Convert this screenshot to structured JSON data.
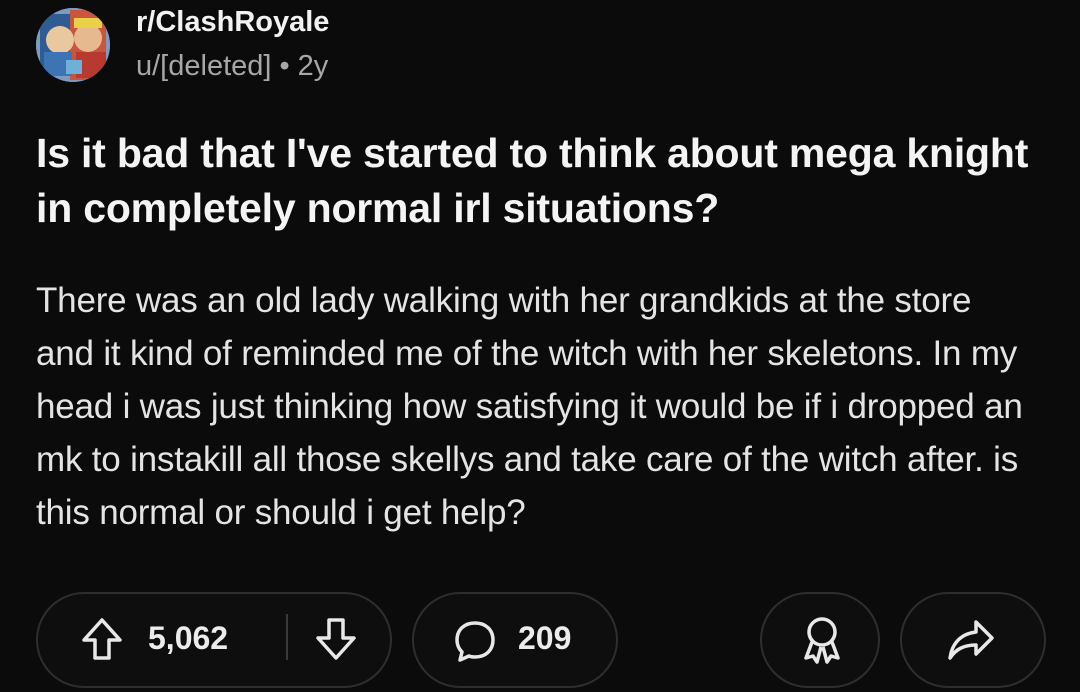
{
  "post": {
    "subreddit": "r/ClashRoyale",
    "author": "u/[deleted]",
    "separator": "•",
    "age": "2y",
    "title": "Is it bad that I've started to think about mega knight in completely normal irl situations?",
    "body": "There was an old lady walking with her grandkids at the store and it kind of reminded me of the witch with her skeletons. In my head i was just thinking how satisfying it would be if i dropped an mk to instakill all those skellys and take care of the witch after. is this normal or should i get help?"
  },
  "actions": {
    "upvote_icon": "arrow-up-icon",
    "vote_count": "5,062",
    "downvote_icon": "arrow-down-icon",
    "comment_icon": "speech-bubble-icon",
    "comment_count": "209",
    "award_icon": "award-ribbon-icon",
    "share_icon": "share-arrow-icon"
  },
  "colors": {
    "background": "#0b0b0b",
    "text_primary": "#f4f4f4",
    "text_secondary": "#a7a7a7",
    "pill_border": "#2e2e2e"
  }
}
